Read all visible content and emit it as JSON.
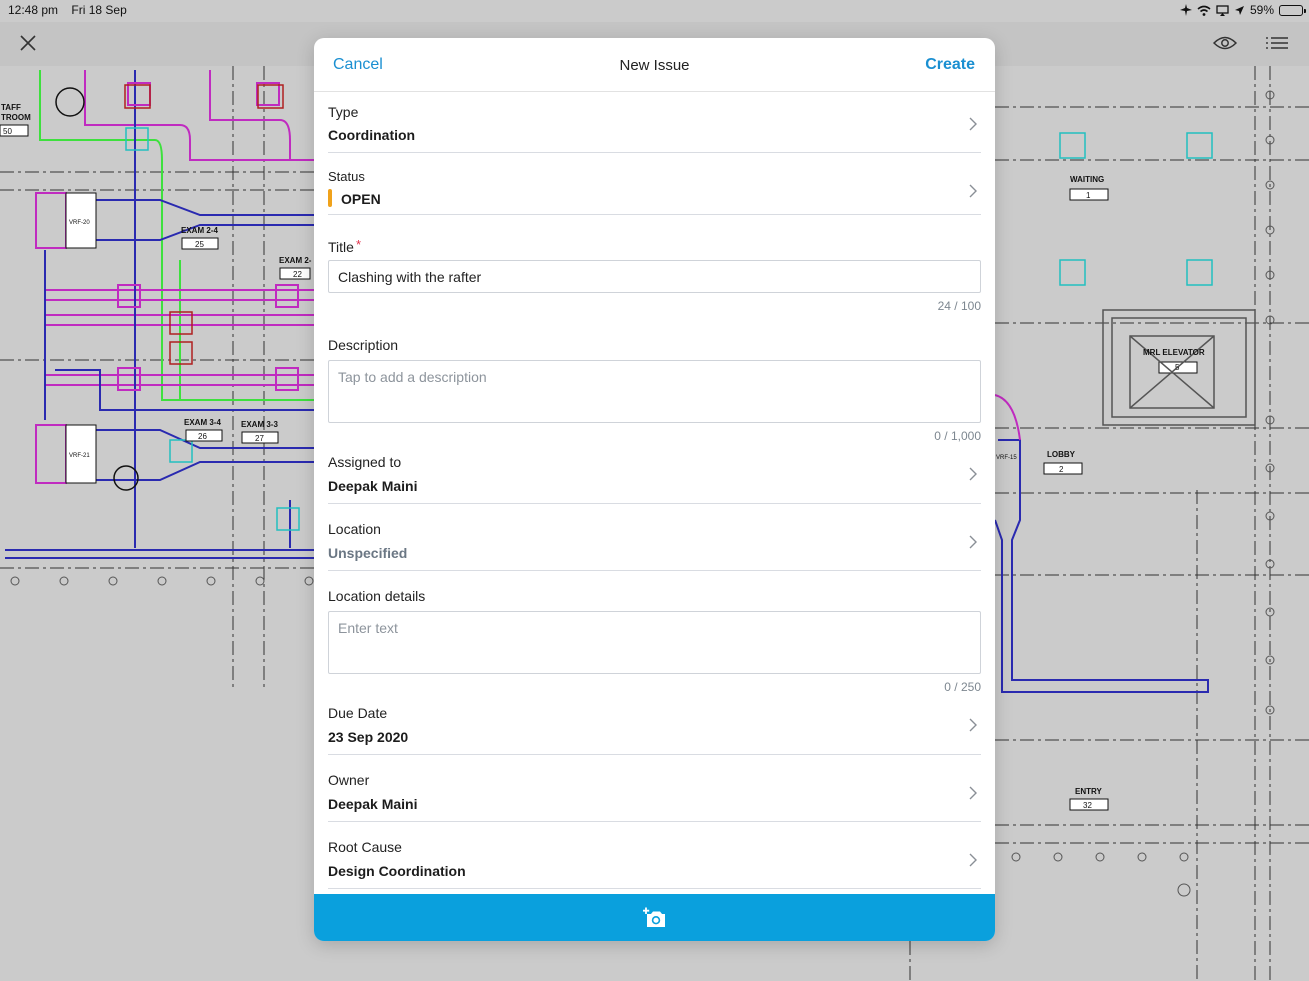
{
  "status_bar": {
    "time": "12:48 pm",
    "date": "Fri 18 Sep",
    "battery_text": "59%",
    "battery_level": 0.59
  },
  "toolbar": {
    "close_icon": "close-icon",
    "eye_icon": "eye-icon",
    "list_icon": "list-icon"
  },
  "drawing": {
    "labels": [
      "TAFF",
      "TROOM",
      "50",
      "VRF-20",
      "EXAM 2-4",
      "25",
      "EXAM 2-",
      "22",
      "EXAM 3-4",
      "26",
      "EXAM 3-3",
      "27",
      "VRF-21",
      "WAITING",
      "1",
      "MRL ELEVATOR",
      "5",
      "LOBBY",
      "2",
      "VRF-15",
      "ENTRY",
      "32"
    ]
  },
  "modal": {
    "cancel": "Cancel",
    "title": "New Issue",
    "create": "Create",
    "type": {
      "label": "Type",
      "value": "Coordination"
    },
    "status": {
      "label": "Status",
      "value": "OPEN",
      "color": "#f0a21b"
    },
    "title_field": {
      "label": "Title",
      "required_mark": "*",
      "value": "Clashing with the rafter",
      "counter": "24 / 100"
    },
    "description": {
      "label": "Description",
      "placeholder": "Tap to add a description",
      "counter": "0 / 1,000"
    },
    "assigned_to": {
      "label": "Assigned to",
      "value": "Deepak Maini"
    },
    "location": {
      "label": "Location",
      "value": "Unspecified"
    },
    "location_details": {
      "label": "Location details",
      "placeholder": "Enter text",
      "counter": "0 / 250"
    },
    "due_date": {
      "label": "Due Date",
      "value": "23 Sep 2020"
    },
    "owner": {
      "label": "Owner",
      "value": "Deepak Maini"
    },
    "root_cause": {
      "label": "Root Cause",
      "value": "Design Coordination"
    },
    "footer_icon": "add-photo-icon",
    "accent": "#1a8fd1",
    "footer_color": "#0aa0dd"
  }
}
